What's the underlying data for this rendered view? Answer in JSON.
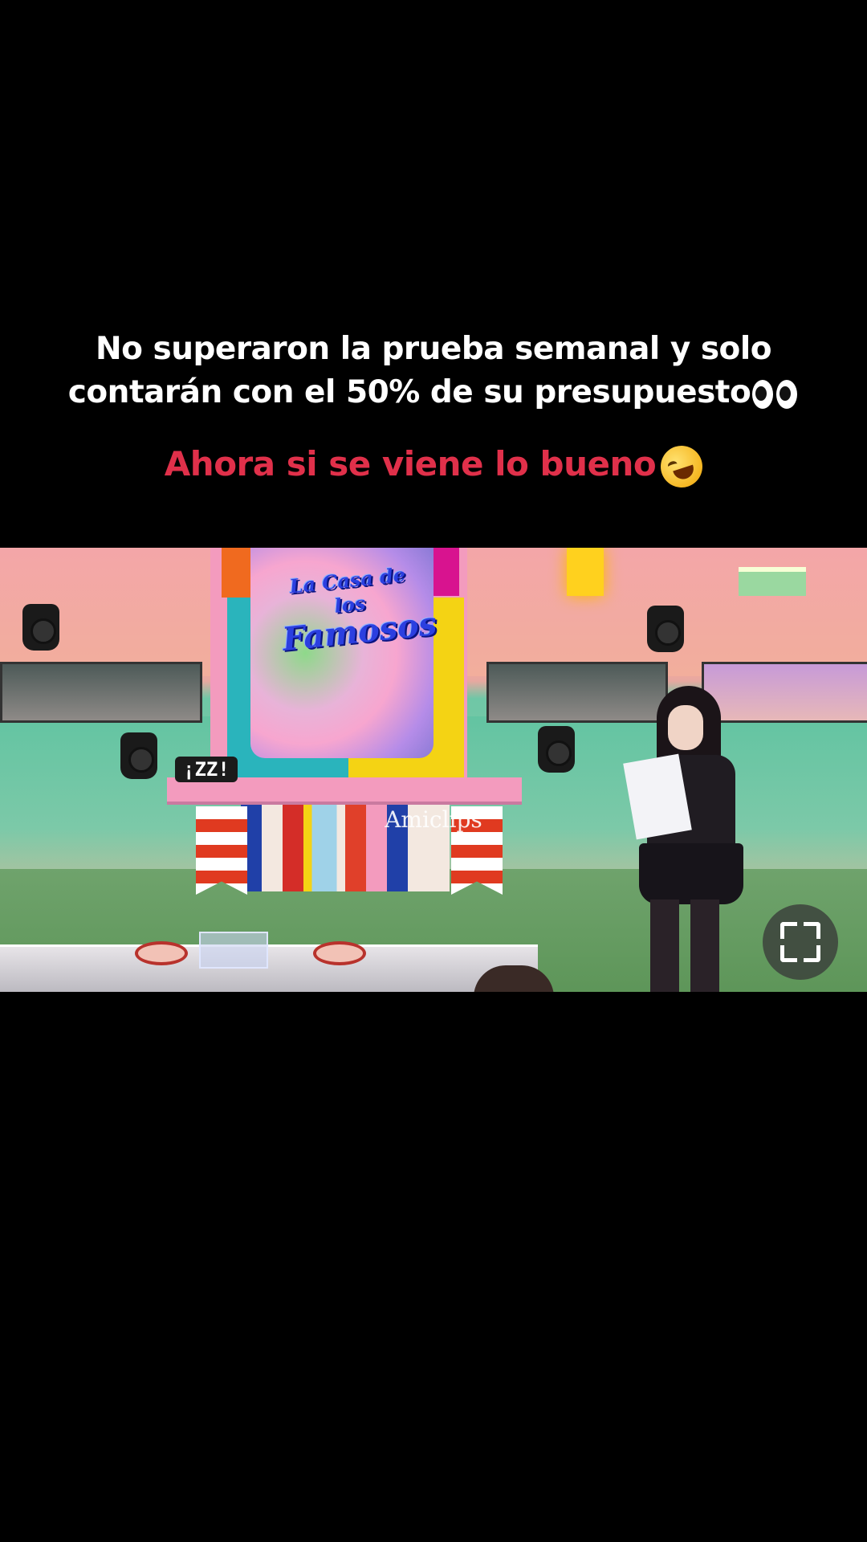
{
  "caption": {
    "line1": "No superaron la prueba semanal y solo",
    "line2": "contarán con el 50% de su presupuesto",
    "line2_emoji": "eyes-emoji",
    "highlight": "Ahora si se viene lo bueno",
    "highlight_emoji": "rolling-laughing-emoji",
    "highlight_color": "#e0304a"
  },
  "video": {
    "logo_line1": "La Casa de los",
    "logo_line2": "Famosos",
    "sign_text": "¡ZZ!",
    "watermark": "Amiclips"
  },
  "controls": {
    "fullscreen_icon": "fullscreen-icon"
  }
}
